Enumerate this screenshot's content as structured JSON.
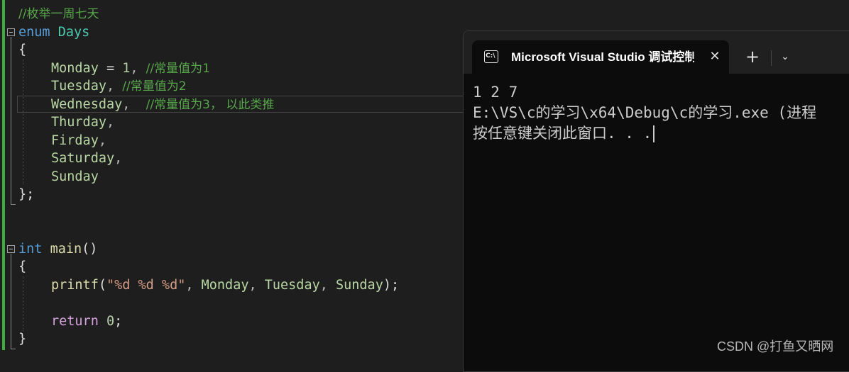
{
  "editor": {
    "comment_top": "//枚举一周七天",
    "enum_kw": "enum",
    "enum_name": "Days",
    "brace_open": "{",
    "members": [
      {
        "name": "Monday",
        "rest": " = ",
        "num": "1",
        "sep": ", ",
        "comment": "//常量值为1"
      },
      {
        "name": "Tuesday",
        "rest": "",
        "num": "",
        "sep": ", ",
        "comment": "//常量值为2"
      },
      {
        "name": "Wednesday",
        "rest": "",
        "num": "",
        "sep": ",  ",
        "comment": "//常量值为3， 以此类推"
      },
      {
        "name": "Thurday",
        "rest": "",
        "num": "",
        "sep": ",",
        "comment": ""
      },
      {
        "name": "Firday",
        "rest": "",
        "num": "",
        "sep": ",",
        "comment": ""
      },
      {
        "name": "Saturday",
        "rest": "",
        "num": "",
        "sep": ",",
        "comment": ""
      },
      {
        "name": "Sunday",
        "rest": "",
        "num": "",
        "sep": "",
        "comment": ""
      }
    ],
    "brace_close_enum": "};",
    "int_kw": "int",
    "main_name": "main",
    "main_parens": "()",
    "brace_open_main": "{",
    "printf_fn": "printf",
    "printf_open": "(",
    "printf_str": "\"%d %d %d\"",
    "printf_args": [
      ", ",
      "Monday",
      ", ",
      "Tuesday",
      ", ",
      "Sunday"
    ],
    "printf_close": ");",
    "return_kw": "return",
    "return_val": "0",
    "return_semi": ";",
    "brace_close_main": "}"
  },
  "terminal": {
    "tab_icon": "C:\\",
    "tab_title": "Microsoft Visual Studio 调试控制台",
    "tab_close": "✕",
    "new_tab": "+",
    "dropdown": "⌄",
    "output_lines": [
      "1 2 7",
      "E:\\VS\\c的学习\\x64\\Debug\\c的学习.exe (进程",
      "按任意键关闭此窗口. . ."
    ]
  },
  "watermark": "CSDN @打鱼又晒网",
  "colors": {
    "editor_bg": "#1e1e1e",
    "terminal_bg": "#0c0c0c",
    "keyword": "#569cd6",
    "comment": "#57a64a",
    "enum_member": "#b8d7a3",
    "type_name": "#4ec9b0",
    "change_bar": "#3fae3f"
  },
  "icons": [
    "fold-toggle-icon",
    "console-icon",
    "close-icon",
    "add-tab-icon",
    "chevron-down-icon"
  ]
}
